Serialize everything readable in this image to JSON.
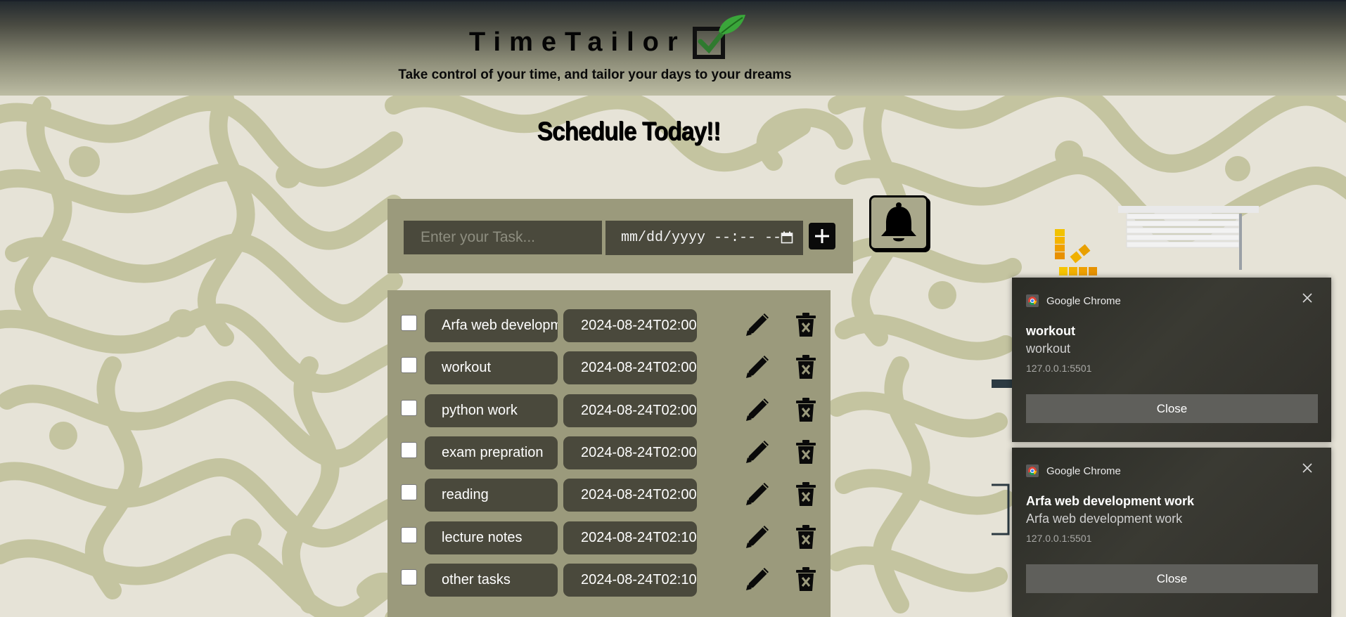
{
  "header": {
    "brand": "TimeTailor",
    "tagline": "Take control of your time, and tailor your days to your dreams"
  },
  "main": {
    "heading": "Schedule Today!!",
    "task_input": {
      "placeholder": "Enter your Task...",
      "value": ""
    },
    "datetime_input": {
      "placeholder": "mm/dd/yyyy --:-- --"
    },
    "add_icon": "plus-icon",
    "bell_icon": "bell-icon"
  },
  "tasks": [
    {
      "name": "Arfa web development work",
      "datetime": "2024-08-24T02:00"
    },
    {
      "name": "workout",
      "datetime": "2024-08-24T02:00"
    },
    {
      "name": "python work",
      "datetime": "2024-08-24T02:00"
    },
    {
      "name": "exam prepration",
      "datetime": "2024-08-24T02:00"
    },
    {
      "name": "reading",
      "datetime": "2024-08-24T02:00"
    },
    {
      "name": "lecture notes",
      "datetime": "2024-08-24T02:10"
    },
    {
      "name": "other tasks",
      "datetime": "2024-08-24T02:10"
    }
  ],
  "notifications": [
    {
      "app": "Google Chrome",
      "title": "workout",
      "body": "workout",
      "origin": "127.0.0.1:5501",
      "action": "Close"
    },
    {
      "app": "Google Chrome",
      "title": "Arfa web development work",
      "body": "Arfa web development work",
      "origin": "127.0.0.1:5501",
      "action": "Close"
    }
  ],
  "colors": {
    "panel": "#9b9a7c",
    "field": "#4a493c",
    "swirl": "#c4c4a0",
    "background": "#e6e3d7"
  }
}
